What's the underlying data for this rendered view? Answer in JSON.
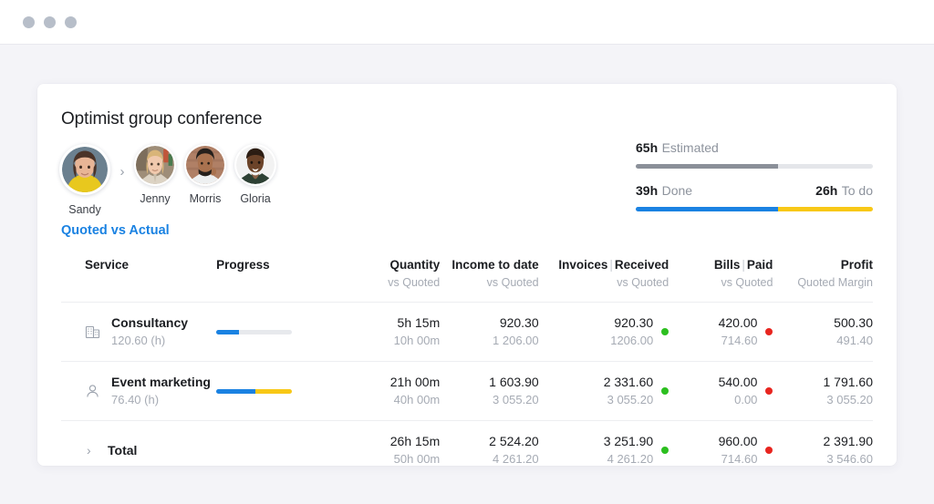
{
  "window": {
    "dots": [
      "minimize-dot",
      "maximize-dot",
      "close-dot"
    ]
  },
  "card": {
    "title": "Optimist group conference",
    "quoted_vs_actual_label": "Quoted vs Actual"
  },
  "team": {
    "chevron": "›",
    "members": [
      {
        "name": "Sandy",
        "primary": true
      },
      {
        "name": "Jenny",
        "primary": false
      },
      {
        "name": "Morris",
        "primary": false
      },
      {
        "name": "Gloria",
        "primary": false
      }
    ]
  },
  "summary": {
    "estimated_value": "65h",
    "estimated_label": "Estimated",
    "estimated_pct": 60,
    "done_value": "39h",
    "done_label": "Done",
    "todo_value": "26h",
    "todo_label": "To do",
    "done_pct": 60
  },
  "table": {
    "columns": [
      {
        "main": "Service",
        "sub": ""
      },
      {
        "main": "Progress",
        "sub": ""
      },
      {
        "main": "Quantity",
        "sub": "vs Quoted"
      },
      {
        "main": "Income to date",
        "sub": "vs Quoted"
      },
      {
        "main": "Invoices",
        "sep": "|",
        "main2": "Received",
        "sub": "vs Quoted"
      },
      {
        "main": "Bills",
        "sep": "|",
        "main2": "Paid",
        "sub": "vs Quoted"
      },
      {
        "main": "Profit",
        "sub": "Quoted Margin"
      }
    ],
    "rows": [
      {
        "icon": "building-icon",
        "service": "Consultancy",
        "service_sub": "120.60 (h)",
        "progress": {
          "blue_pct": 30,
          "yellow_pct": 0
        },
        "quantity": "5h 15m",
        "quantity_sub": "10h 00m",
        "income": "920.30",
        "income_sub": "1 206.00",
        "invoices": "920.30",
        "invoices_sub": "1206.00",
        "invoices_dot": "#2cbf1f",
        "bills": "420.00",
        "bills_sub": "714.60",
        "bills_dot": "#e8251f",
        "profit": "500.30",
        "profit_sub": "491.40"
      },
      {
        "icon": "person-icon",
        "service": "Event marketing",
        "service_sub": "76.40 (h)",
        "progress": {
          "blue_pct": 52,
          "yellow_pct": 48
        },
        "quantity": "21h 00m",
        "quantity_sub": "40h 00m",
        "income": "1 603.90",
        "income_sub": "3 055.20",
        "invoices": "2 331.60",
        "invoices_sub": "3 055.20",
        "invoices_dot": "#2cbf1f",
        "bills": "540.00",
        "bills_sub": "0.00",
        "bills_dot": "#e8251f",
        "profit": "1 791.60",
        "profit_sub": "3 055.20"
      }
    ],
    "total": {
      "chevron": "›",
      "label": "Total",
      "quantity": "26h 15m",
      "quantity_sub": "50h 00m",
      "income": "2 524.20",
      "income_sub": "4 261.20",
      "invoices": "3 251.90",
      "invoices_sub": "4 261.20",
      "invoices_dot": "#2cbf1f",
      "bills": "960.00",
      "bills_sub": "714.60",
      "bills_dot": "#e8251f",
      "profit": "2 391.90",
      "profit_sub": "3 546.60"
    }
  },
  "colors": {
    "accent_blue": "#1a82e2",
    "yellow": "#f8c816",
    "green": "#2cbf1f",
    "red": "#e8251f",
    "gray_bar": "#8b9099"
  }
}
